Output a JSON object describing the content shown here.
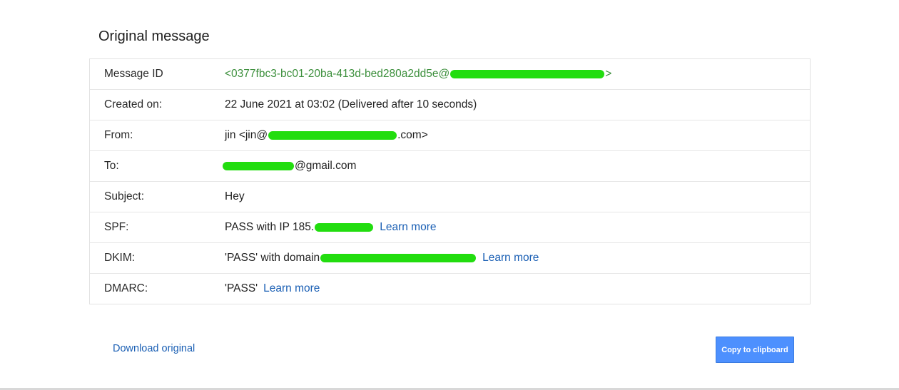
{
  "title": "Original message",
  "rows": {
    "message_id": {
      "label": "Message ID",
      "prefix": "<0377fbc3-bc01-20ba-413d-bed280a2dd5e@",
      "suffix": ">"
    },
    "created": {
      "label": "Created on:",
      "value": "22 June 2021 at 03:02 (Delivered after 10 seconds)"
    },
    "from": {
      "label": "From:",
      "prefix": "jin <jin@",
      "suffix": ".com>"
    },
    "to": {
      "label": "To:",
      "suffix": "@gmail.com"
    },
    "subject": {
      "label": "Subject:",
      "value": "Hey"
    },
    "spf": {
      "label": "SPF:",
      "prefix": "PASS with IP 185.",
      "link": "Learn more"
    },
    "dkim": {
      "label": "DKIM:",
      "prefix": "'PASS' with domain",
      "link": "Learn more"
    },
    "dmarc": {
      "label": "DMARC:",
      "prefix": "'PASS'",
      "link": "Learn more"
    }
  },
  "actions": {
    "download": "Download original",
    "copy": "Copy to clipboard"
  },
  "colors": {
    "redaction": "#22dd0f",
    "link": "#1a5fb4",
    "message_id_text": "#3c8f3c",
    "button": "#4d90fe"
  }
}
